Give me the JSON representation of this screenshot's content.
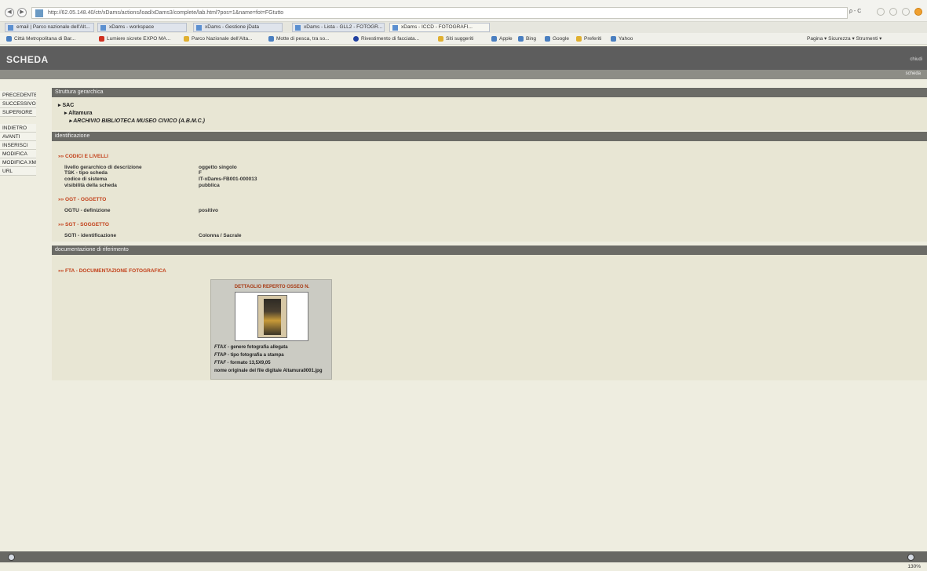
{
  "browser": {
    "url": "http://62.05.148.40/ctr/xDams/actions/load/xDams3/complete/lab.html?pos=1&name=fot=FGtutto",
    "search_hint": "ρ - C",
    "tabs": [
      {
        "label": "email | Parco nazionale dell'Alt..."
      },
      {
        "label": "xDams - workspace"
      },
      {
        "label": "xDams - Gestione jData"
      },
      {
        "label": "xDams - Lista - GLL2 - FOTOGR..."
      },
      {
        "label": "xDams - ICCD - FOTOGRAFI..."
      }
    ],
    "bookmarks": [
      {
        "label": "Città Metropolitana di Bar..."
      },
      {
        "label": "Lumiere sicrete EXPO MA..."
      },
      {
        "label": "Parco Nazionale dell'Alta..."
      },
      {
        "label": "Motte di pesca, tra so..."
      },
      {
        "label": "Rivestimento di facciata..."
      },
      {
        "label": "Siti suggeriti"
      },
      {
        "label": "Apple"
      },
      {
        "label": "Bing"
      },
      {
        "label": "Google"
      },
      {
        "label": "Preferiti"
      },
      {
        "label": "Yahoo"
      }
    ],
    "command_bar": "Pagina ▾   Sicurezza ▾   Strumenti ▾",
    "zoom": "130%"
  },
  "header": {
    "title": "SCHEDA",
    "right_link": "chiudi",
    "sub_right_link": "scheda"
  },
  "menu": {
    "group1": [
      "PRECEDENTE",
      "SUCCESSIVO",
      "SUPERIORE"
    ],
    "group2": [
      "INDIETRO",
      "AVANTI",
      "INSERISCI",
      "MODIFICA",
      "MODIFICA XML",
      "URL"
    ]
  },
  "sections": {
    "struttura": {
      "title": "Struttura gerarchica",
      "tree": [
        "SAC",
        "Altamura",
        "ARCHIVIO BIBLIOTECA MUSEO CIVICO (A.B.M.C.)"
      ]
    },
    "identificazione": {
      "title": "identificazione",
      "groups": [
        {
          "title": "CODICI E LIVELLI",
          "fields": [
            {
              "label": "livello gerarchico di descrizione",
              "value": "oggetto singolo"
            },
            {
              "label": "TSK - tipo scheda",
              "value": "F"
            },
            {
              "label": "codice di sistema",
              "value": "IT-xDams-FB001-000013"
            },
            {
              "label": "visibilità della scheda",
              "value": "pubblica"
            }
          ]
        },
        {
          "title": "OGT - OGGETTO",
          "fields": [
            {
              "label": "OGTU - definizione",
              "value": "positivo"
            }
          ]
        },
        {
          "title": "SGT - SOGGETTO",
          "fields": [
            {
              "label": "SGTI - identificazione",
              "value": "Colonna / Sacrale"
            }
          ]
        }
      ]
    },
    "documentazione": {
      "title": "documentazione di riferimento",
      "group_title": "FTA - DOCUMENTAZIONE FOTOGRAFICA",
      "photo": {
        "caption": "DETTAGLIO REPERTO OSSEO N.",
        "lines": [
          {
            "key": "FTAX",
            "text": "genere fotografia allegata"
          },
          {
            "key": "FTAP",
            "text": "tipo fotografia a stampa"
          },
          {
            "key": "FTAF",
            "text": "formato 13,5X9,05"
          },
          {
            "key": "",
            "text": "nome originale del file digitale Altamura0001.jpg"
          }
        ]
      }
    }
  }
}
